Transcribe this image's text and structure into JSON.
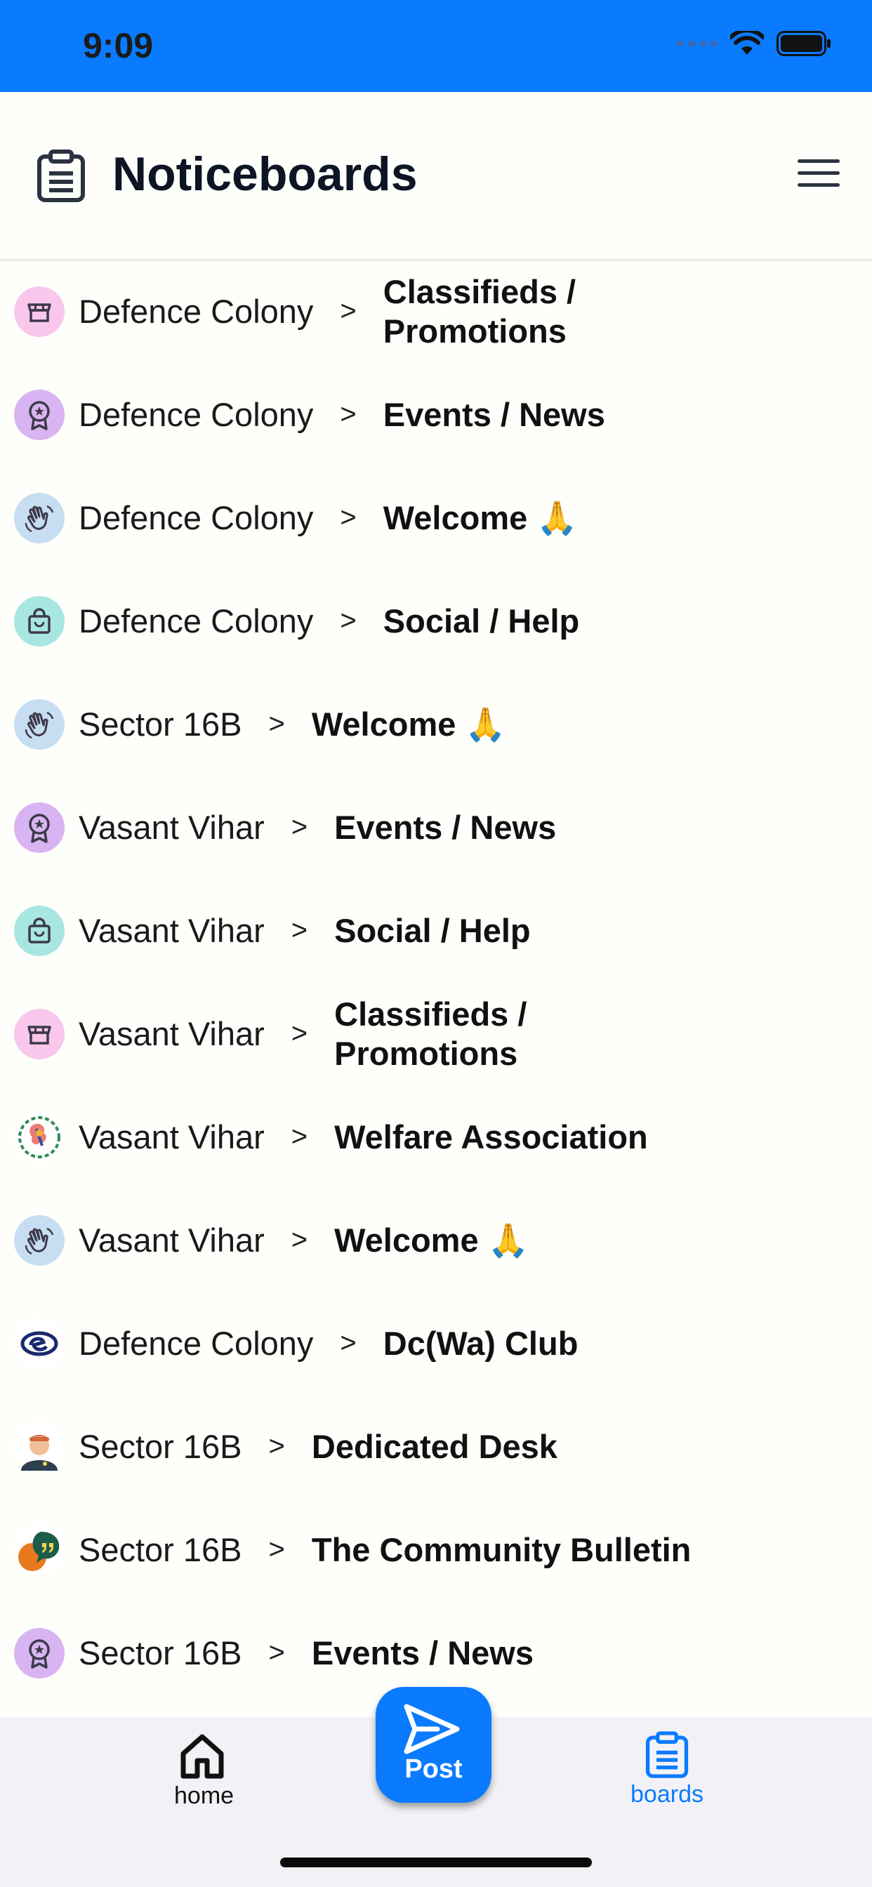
{
  "status_bar": {
    "time": "9:09"
  },
  "header": {
    "title": "Noticeboards"
  },
  "boards": [
    {
      "area": "Defence Colony",
      "separator": ">",
      "board": "Classifieds / Promotions",
      "icon": "shop-icon",
      "icon_bg": "#f9c7ec"
    },
    {
      "area": "Defence Colony",
      "separator": ">",
      "board": "Events / News",
      "icon": "award-icon",
      "icon_bg": "#d9b4f2"
    },
    {
      "area": "Defence Colony",
      "separator": ">",
      "board": "Welcome 🙏",
      "icon": "wave-hand-icon",
      "icon_bg": "#c7def2"
    },
    {
      "area": "Defence Colony",
      "separator": ">",
      "board": "Social / Help",
      "icon": "bag-icon",
      "icon_bg": "#a8e6e1"
    },
    {
      "area": "Sector 16B",
      "separator": ">",
      "board": "Welcome 🙏",
      "icon": "wave-hand-icon",
      "icon_bg": "#c7def2"
    },
    {
      "area": "Vasant Vihar",
      "separator": ">",
      "board": "Events / News",
      "icon": "award-icon",
      "icon_bg": "#d9b4f2"
    },
    {
      "area": "Vasant Vihar",
      "separator": ">",
      "board": "Social / Help",
      "icon": "bag-icon",
      "icon_bg": "#a8e6e1"
    },
    {
      "area": "Vasant Vihar",
      "separator": ">",
      "board": "Classifieds / Promotions",
      "icon": "shop-icon",
      "icon_bg": "#f9c7ec"
    },
    {
      "area": "Vasant Vihar",
      "separator": ">",
      "board": "Welfare Association",
      "icon": "emblem-logo-icon",
      "icon_bg": "#ffffff"
    },
    {
      "area": "Vasant Vihar",
      "separator": ">",
      "board": "Welcome 🙏",
      "icon": "wave-hand-icon",
      "icon_bg": "#c7def2"
    },
    {
      "area": "Defence Colony",
      "separator": ">",
      "board": "Dc(Wa) Club",
      "icon": "club-logo-icon",
      "icon_bg": "#ffffff"
    },
    {
      "area": "Sector 16B",
      "separator": ">",
      "board": "Dedicated Desk",
      "icon": "person-avatar-icon",
      "icon_bg": "#ffffff"
    },
    {
      "area": "Sector 16B",
      "separator": ">",
      "board": "The Community Bulletin",
      "icon": "quote-bubble-icon",
      "icon_bg": "#ffffff"
    },
    {
      "area": "Sector 16B",
      "separator": ">",
      "board": "Events / News",
      "icon": "award-icon",
      "icon_bg": "#d9b4f2"
    }
  ],
  "bottom_nav": {
    "home_label": "home",
    "post_label": "Post",
    "boards_label": "boards",
    "accent": "#0a7bff"
  }
}
